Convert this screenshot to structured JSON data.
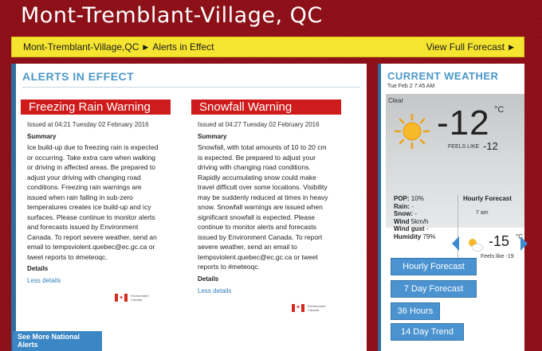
{
  "site": {
    "title": "Mont-Tremblant-Village, QC"
  },
  "breadcrumb": {
    "location": "Mont-Tremblant-Village,QC",
    "current": "Alerts in Effect",
    "view_full_forecast": "View Full Forecast"
  },
  "alerts_section": {
    "title": "ALERTS IN EFFECT",
    "see_more": "See More National Alerts",
    "alerts": [
      {
        "name": "Freezing Rain Warning",
        "issued": "Issued at 04:21 Tuesday 02 February 2016",
        "summary_label": "Summary",
        "summary": "Ice build-up due to freezing rain is expected or occurring. Take extra care when walking or driving in affected areas. Be prepared to adjust your driving with changing road conditions. Freezing rain warnings are issued when rain falling in sub-zero temperatures creates ice build-up and icy surfaces. Please continue to monitor alerts and forecasts issued by Environment Canada. To report severe weather, send an email to tempsviolent.quebec@ec.gc.ca or tweet reports to #meteoqc.",
        "details_label": "Details",
        "less_details": "Less details",
        "logo_text": [
          "Environment",
          "Canada"
        ]
      },
      {
        "name": "Snowfall Warning",
        "issued": "Issued at 04:27 Tuesday 02 February 2016",
        "summary_label": "Summary",
        "summary": "Snowfall, with total amounts of 10 to 20 cm is expected. Be prepared to adjust your driving with changing road conditions. Rapidly accumulating snow could make travel difficult over some locations. Visibility may be suddenly reduced at times in heavy snow. Snowfall warnings are issued when significant snowfall is expected. Please continue to monitor alerts and forecasts issued by Environment Canada. To report severe weather, send an email to tempsviolent.quebec@ec.gc.ca or tweet reports to #meteoqc.",
        "details_label": "Details",
        "less_details": "Less details",
        "logo_text": [
          "Environment",
          "Canada"
        ]
      }
    ]
  },
  "current_weather": {
    "title": "CURRENT WEATHER",
    "time": "Tue Feb 2 7:45 AM",
    "condition": "Clear",
    "temp": "-12",
    "unit": "°C",
    "feels_like_label": "FEELS LIKE",
    "feels_like": "-12",
    "stats": [
      {
        "label": "POP:",
        "value": "10%"
      },
      {
        "label": "Rain:",
        "value": "-"
      },
      {
        "label": "Snow:",
        "value": "-"
      },
      {
        "label": "Wind",
        "value": "5km/h"
      },
      {
        "label": "Wind gust",
        "value": "-"
      },
      {
        "label": "Humidity",
        "value": "79%"
      }
    ],
    "hourly": {
      "title": "Hourly Forecast",
      "time": "7 am",
      "temp": "-15",
      "unit": "°C",
      "feels_like": "Feels like -19"
    }
  },
  "side_buttons": {
    "hourly": "Hourly Forecast",
    "seven_day": "7 Day Forecast",
    "thirty_six": "36 Hours",
    "fourteen_day": "14 Day Trend"
  },
  "colors": {
    "background": "#8e0e17",
    "yellow_bar": "#f5e530",
    "alert_red": "#cf1b1b",
    "accent_blue": "#4b97c8",
    "button_blue": "#4a93d0"
  }
}
